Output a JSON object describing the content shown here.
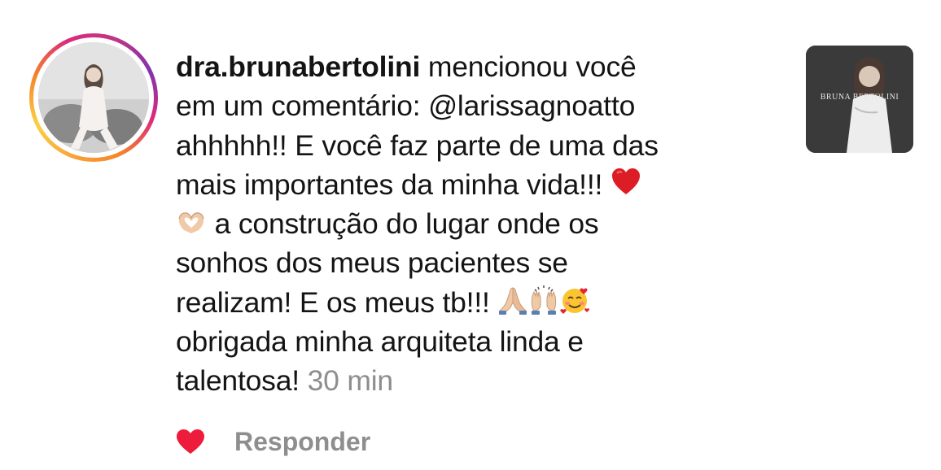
{
  "notification": {
    "username": "dra.brunabertolini",
    "lines": {
      "l1_rest": " mencionou você",
      "l2": "em um comentário: @larissagnoatto",
      "l3": "ahhhhh!! E você faz parte de uma das",
      "l4": "mais importantes da minha vida!!! ",
      "l5": " a construção do lugar onde os",
      "l6": "sonhos dos meus pacientes se",
      "l7": "realizam! E os meus tb!!! ",
      "l8": "obrigada minha arquiteta linda e",
      "l9": "talentosa! "
    },
    "time": "30 min",
    "emojis": [
      "red-heart",
      "heart-hands",
      "folded-hands",
      "raising-hands",
      "smiling-face-with-hearts"
    ]
  },
  "post_thumbnail": {
    "title": "BRUNA BERTOLINI"
  },
  "actions": {
    "reply_label": "Responder",
    "like_icon": "heart-icon"
  },
  "colors": {
    "text": "#141414",
    "muted": "#8e8e8e",
    "heart": "#ed1c3b"
  }
}
